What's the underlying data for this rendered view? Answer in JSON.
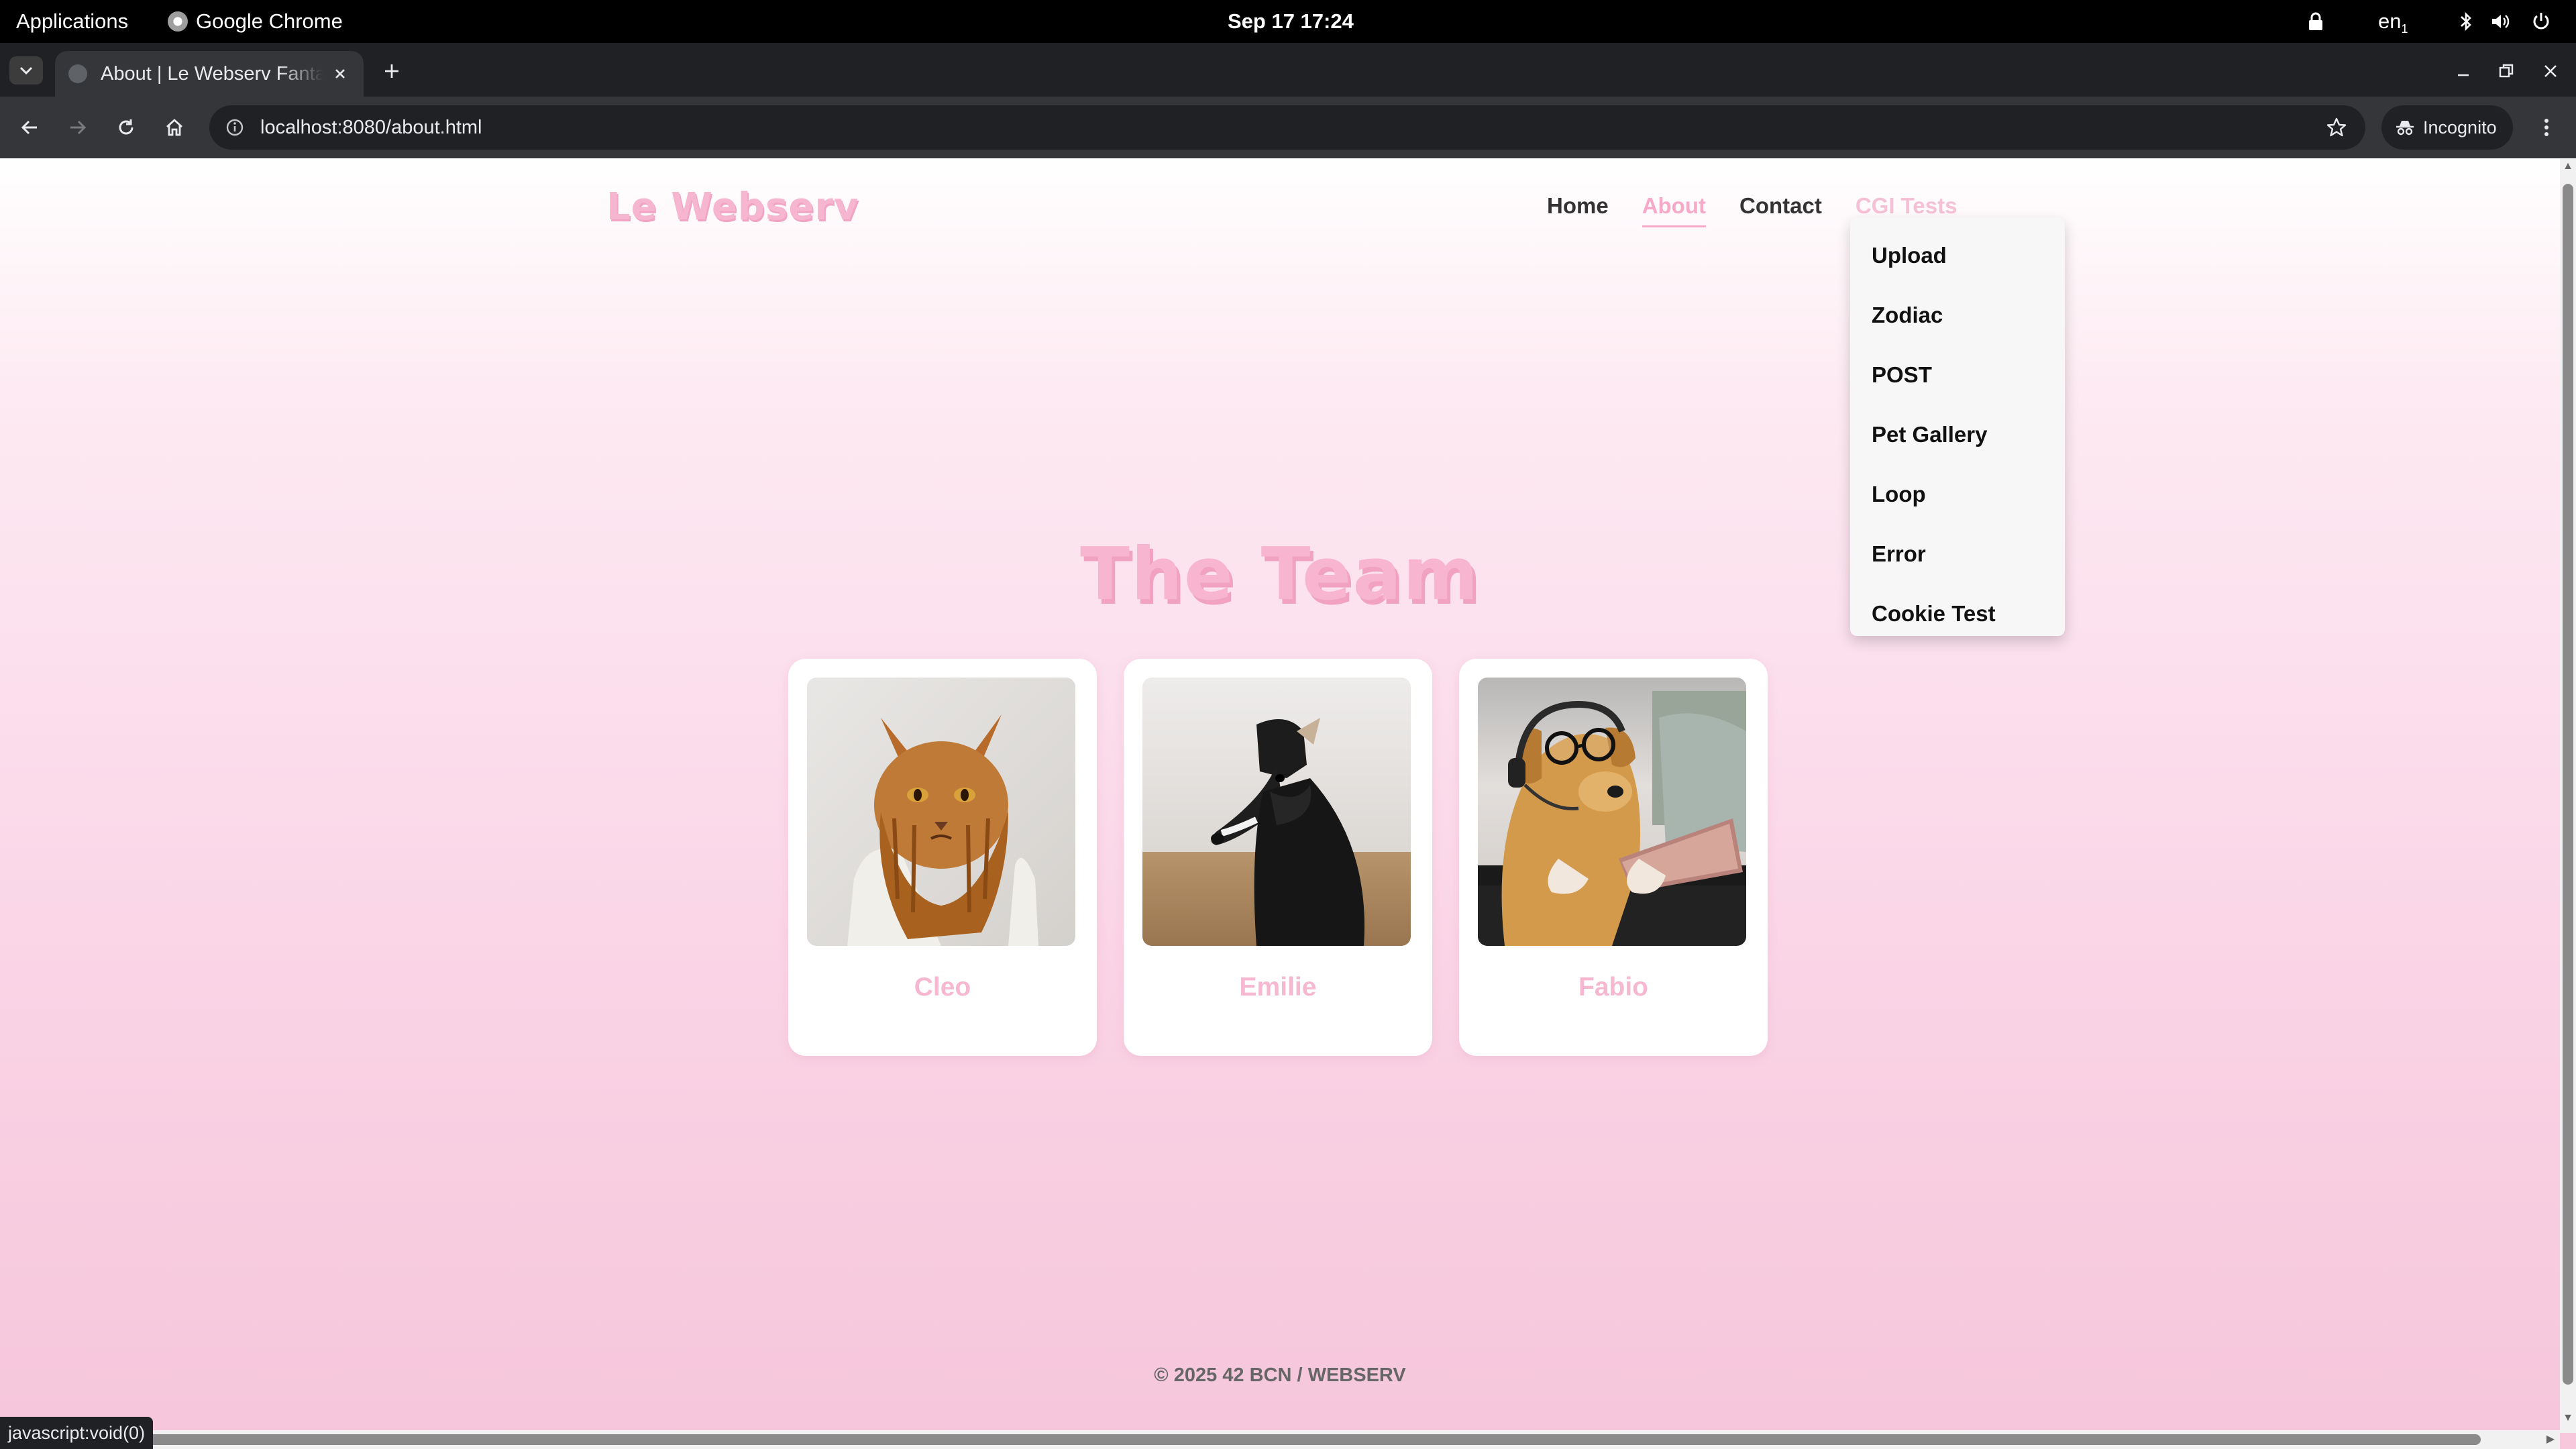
{
  "topbar": {
    "applications": "Applications",
    "app_name": "Google Chrome",
    "clock": "Sep 17  17:24",
    "language": "en",
    "icons": [
      "lock-icon",
      "bluetooth-icon",
      "volume-icon",
      "power-icon"
    ]
  },
  "browser": {
    "tab_title": "About | Le Webserv Fantastic",
    "url": "localhost:8080/about.html",
    "incognito_label": "Incognito",
    "status_text": "javascript:void(0)"
  },
  "site": {
    "logo": "Le Webserv",
    "nav": {
      "home": "Home",
      "about": "About",
      "contact": "Contact",
      "cgi": "CGI Tests"
    },
    "dropdown": [
      "Upload",
      "Zodiac",
      "POST",
      "Pet Gallery",
      "Loop",
      "Error",
      "Cookie Test"
    ],
    "team_title": "The Team",
    "members": [
      {
        "name": "Cleo"
      },
      {
        "name": "Emilie"
      },
      {
        "name": "Fabio"
      }
    ],
    "footer": "© 2025 42 BCN / WEBSERV"
  },
  "colors": {
    "accent_pink": "#f6a9c8",
    "title_pink": "#f7b5cf",
    "chrome_dark": "#202124",
    "chrome_toolbar": "#35363a"
  }
}
